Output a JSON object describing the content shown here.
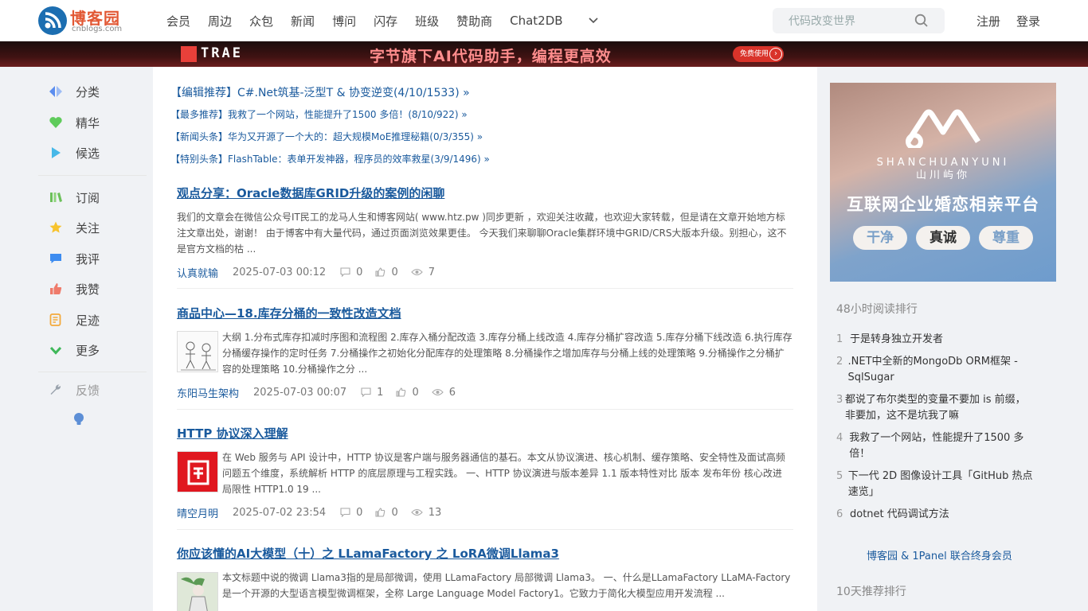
{
  "brand": {
    "name": "博客园",
    "domain": "cnblogs.com",
    "color": "#1c6eb1"
  },
  "nav": {
    "items": [
      "会员",
      "周边",
      "众包",
      "新闻",
      "博问",
      "闪存",
      "班级",
      "赞助商",
      "Chat2DB"
    ],
    "more_icon": "chevron-down-icon",
    "search_placeholder": "代码改变世界",
    "register": "注册",
    "login": "登录"
  },
  "banner": {
    "brand": "TRAE",
    "slogan": "字节旗下AI代码助手，编程更高效",
    "cta": "免费使用"
  },
  "sidebar": {
    "items": [
      {
        "label": "分类",
        "icon": "category-icon"
      },
      {
        "label": "精华",
        "icon": "heart-icon"
      },
      {
        "label": "候选",
        "icon": "play-icon"
      },
      {
        "label": "订阅",
        "icon": "books-icon"
      },
      {
        "label": "关注",
        "icon": "star-icon"
      },
      {
        "label": "我评",
        "icon": "comment-icon"
      },
      {
        "label": "我赞",
        "icon": "thumbs-up-icon"
      },
      {
        "label": "足迹",
        "icon": "footprint-icon"
      },
      {
        "label": "更多",
        "icon": "chevron-down-icon"
      },
      {
        "label": "反馈",
        "icon": "wrench-icon"
      }
    ],
    "bulb_icon": "lightbulb-icon"
  },
  "recommendations": [
    "【编辑推荐】C#.Net筑基-泛型T & 协变逆变(4/10/1533) »",
    "【最多推荐】我救了一个网站，性能提升了1500 多倍！(8/10/922) »",
    "【新闻头条】华为又开源了一个大的：超大规模MoE推理秘籍(0/3/355) »",
    "【特别头条】FlashTable：表单开发神器，程序员的效率救星(3/9/1496) »"
  ],
  "posts": [
    {
      "title": "观点分享：Oracle数据库GRID升级的案例的闲聊",
      "summary": "我们的文章会在微信公众号IT民工的龙马人生和博客网站( www.htz.pw )同步更新 ，欢迎关注收藏，也欢迎大家转载，但是请在文章开始地方标注文章出处，谢谢！ 由于博客中有大量代码，通过页面浏览效果更佳。 今天我们来聊聊Oracle集群环境中GRID/CRS大版本升级。别担心，这不是官方文档的枯 ...",
      "author": "认真就输",
      "date": "2025-07-03 00:12",
      "comments": "0",
      "likes": "0",
      "views": "7",
      "thumb": ""
    },
    {
      "title": "商品中心—18.库存分桶的一致性改造文档",
      "summary": "大纲 1.分布式库存扣减时序图和流程图 2.库存入桶分配改造 3.库存分桶上线改造 4.库存分桶扩容改造 5.库存分桶下线改造 6.执行库存分桶缓存操作的定时任务 7.分桶操作之初始化分配库存的处理策略 8.分桶操作之增加库存与分桶上线的处理策略 9.分桶操作之分桶扩容的处理策略 10.分桶操作之分 ...",
      "author": "东阳马生架构",
      "date": "2025-07-03 00:07",
      "comments": "1",
      "likes": "0",
      "views": "6",
      "thumb": "sketch"
    },
    {
      "title": "HTTP 协议深入理解",
      "summary": "在 Web 服务与 API 设计中，HTTP 协议是客户端与服务器通信的基石。本文从协议演进、核心机制、缓存策略、安全特性及面试高频问题五个维度，系统解析 HTTP 的底层原理与工程实践。 一、HTTP 协议演进与版本差异 1.1 版本特性对比 版本 发布年份 核心改进 局限性 HTTP1.0 19 ...",
      "author": "晴空月明",
      "date": "2025-07-02 23:54",
      "comments": "0",
      "likes": "0",
      "views": "13",
      "thumb": "red"
    },
    {
      "title": "你应该懂的AI大模型（十）之 LLamaFactory 之 LoRA微调Llama3",
      "summary": "本文标题中说的微调 Llama3指的是局部微调，使用 LLamaFactory 局部微调 Llama3。 一、什么是LLamaFactory LLaMA-Factory 是一个开源的大型语言模型微调框架，全称 Large Language Model Factory1。它致力于简化大模型应用开发流程 ...",
      "author": "",
      "date": "",
      "comments": "",
      "likes": "",
      "views": "",
      "thumb": "anime"
    }
  ],
  "ad": {
    "brand": "SHANCHUANYUNI",
    "brand_cn": "山川屿你",
    "slogan": "互联网企业婚恋相亲平台",
    "tags": [
      "干净",
      "真诚",
      "尊重"
    ]
  },
  "rank48": {
    "heading": "48小时阅读排行",
    "items": [
      "于是转身独立开发者",
      ".NET中全新的MongoDb ORM框架 - SqlSugar",
      "都说了布尔类型的变量不要加 is 前缀，非要加，这不是坑我了嘛",
      "我救了一个网站，性能提升了1500 多倍！",
      "下一代 2D 图像设计工具「GitHub 热点速览」",
      "dotnet 代码调试方法"
    ]
  },
  "member_link": "博客园 & 1Panel 联合终身会员",
  "rank10_heading": "10天推荐排行"
}
